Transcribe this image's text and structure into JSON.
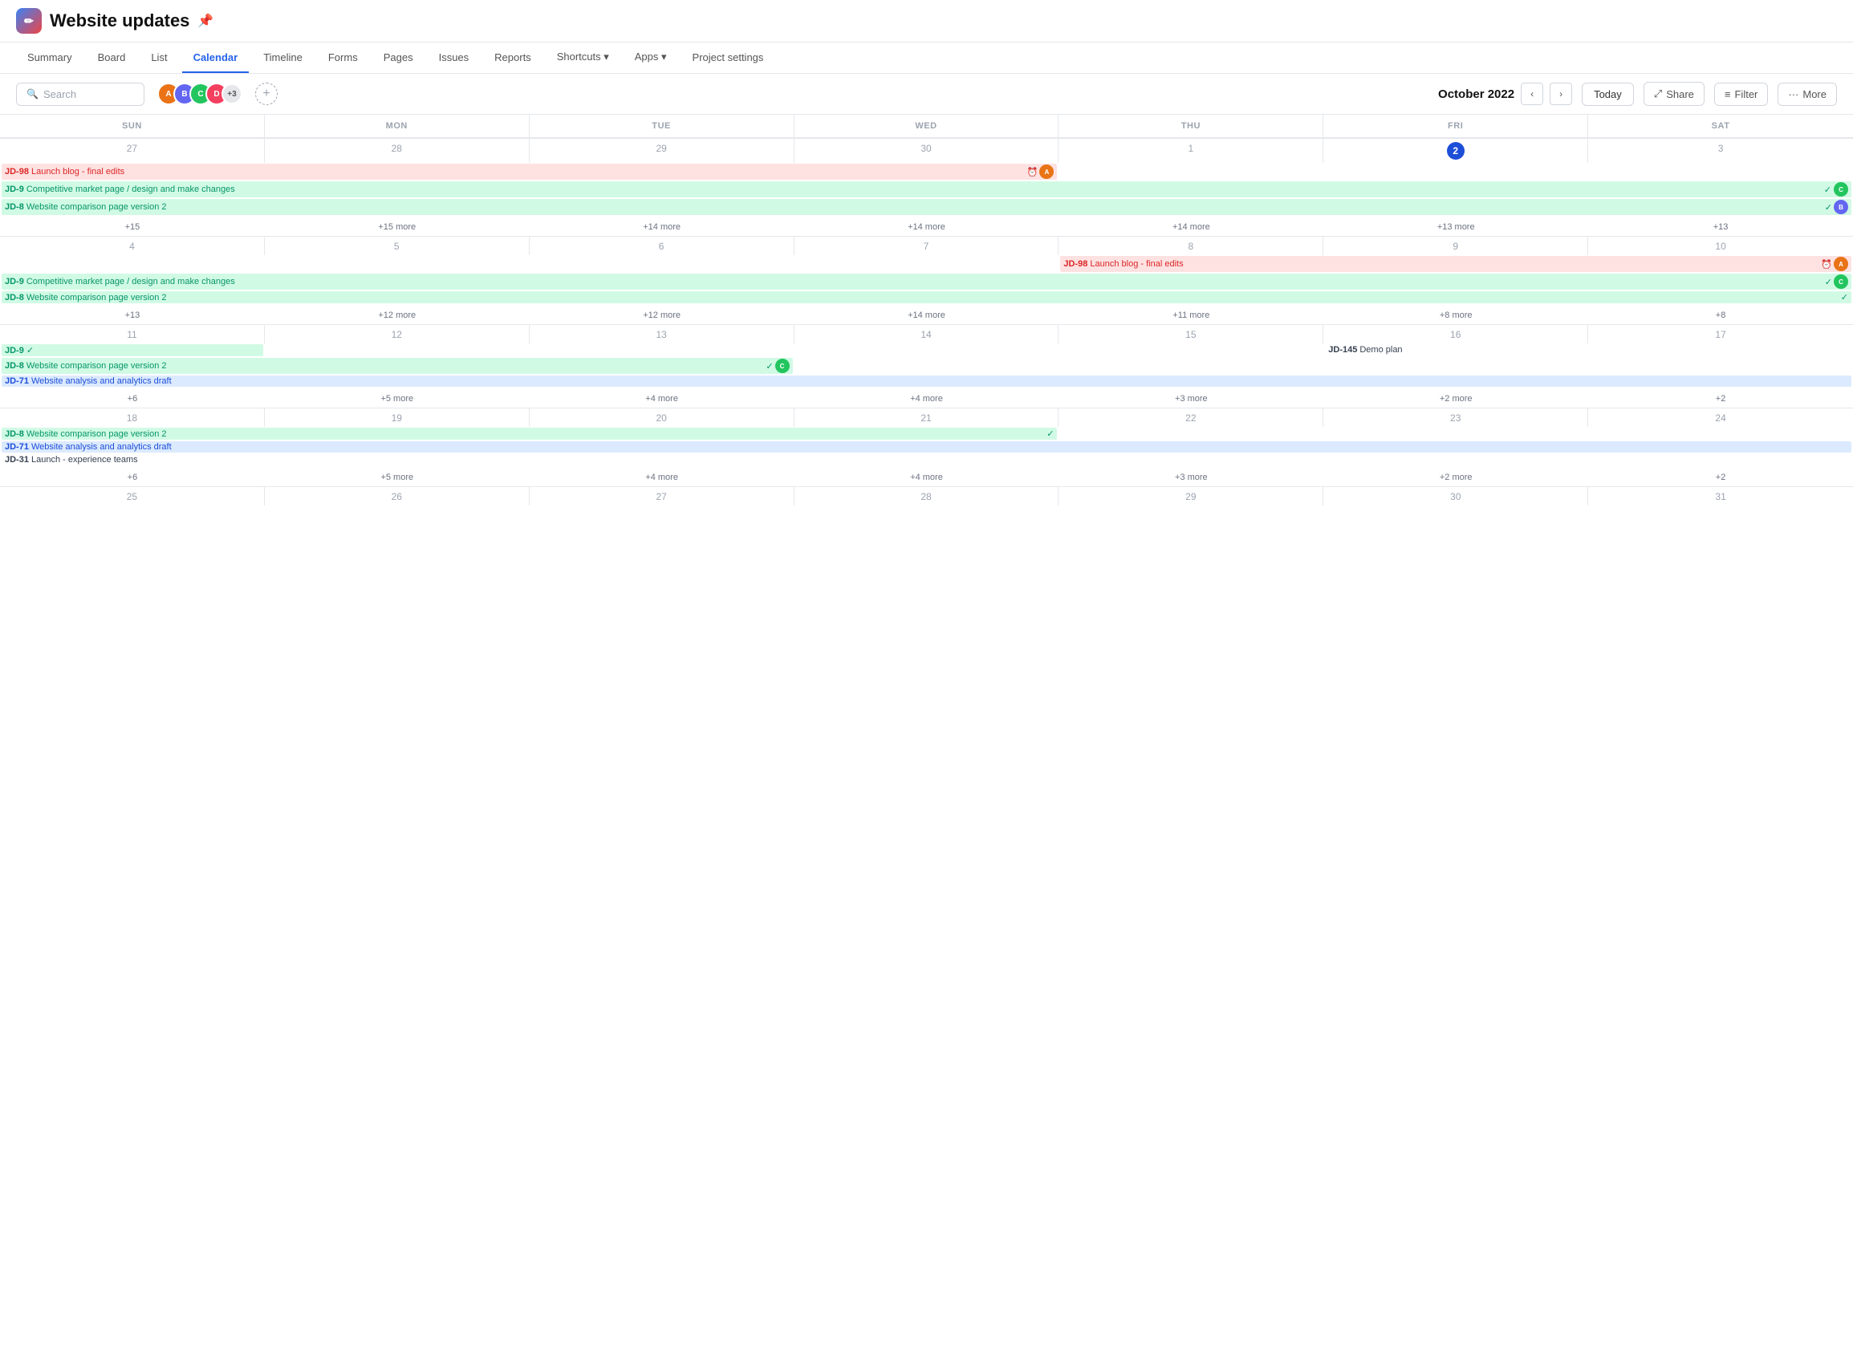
{
  "app": {
    "logo": "✏",
    "title": "Website updates",
    "pin_icon": "📌"
  },
  "nav": {
    "tabs": [
      {
        "id": "summary",
        "label": "Summary",
        "active": false
      },
      {
        "id": "board",
        "label": "Board",
        "active": false
      },
      {
        "id": "list",
        "label": "List",
        "active": false
      },
      {
        "id": "calendar",
        "label": "Calendar",
        "active": true
      },
      {
        "id": "timeline",
        "label": "Timeline",
        "active": false
      },
      {
        "id": "forms",
        "label": "Forms",
        "active": false
      },
      {
        "id": "pages",
        "label": "Pages",
        "active": false
      },
      {
        "id": "issues",
        "label": "Issues",
        "active": false
      },
      {
        "id": "reports",
        "label": "Reports",
        "active": false
      },
      {
        "id": "shortcuts",
        "label": "Shortcuts ▾",
        "active": false
      },
      {
        "id": "apps",
        "label": "Apps ▾",
        "active": false
      },
      {
        "id": "project-settings",
        "label": "Project settings",
        "active": false
      }
    ]
  },
  "toolbar": {
    "search_placeholder": "Search",
    "month_title": "October 2022",
    "today_label": "Today",
    "share_label": "Share",
    "filter_label": "Filter",
    "more_label": "More",
    "avatar_extra": "+3"
  },
  "calendar": {
    "day_headers": [
      "SUN",
      "MON",
      "TUE",
      "WED",
      "THU",
      "FRI",
      "SAT"
    ],
    "weeks": [
      {
        "days": [
          27,
          28,
          29,
          30,
          1,
          2,
          3
        ],
        "today_index": 5,
        "spanning_events": [
          {
            "label": "JD-98 Launch blog - final edits",
            "id": "JD-98",
            "title": "Launch blog - final edits",
            "type": "red",
            "start": 0,
            "end": 3,
            "has_overdue": true,
            "avatar_color": "#e97316"
          },
          {
            "label": "JD-9 Competitive market page / design and make changes",
            "id": "JD-9",
            "title": "Competitive market page / design and make changes",
            "type": "teal",
            "start": 0,
            "end": 6,
            "has_check": false
          },
          {
            "label": "JD-8 Website comparison page version 2",
            "id": "JD-8",
            "title": "Website comparison page version 2",
            "type": "teal",
            "start": 0,
            "end": 6,
            "has_check": true,
            "avatar_color": "#6366f1"
          }
        ],
        "more_counts": [
          15,
          15,
          14,
          14,
          14,
          13,
          13
        ]
      },
      {
        "days": [
          4,
          5,
          6,
          7,
          8,
          9,
          10
        ],
        "today_index": -1,
        "spanning_events": [
          {
            "label": "JD-98 Launch blog - final edits",
            "id": "JD-98",
            "title": "Launch blog - final edits",
            "type": "red",
            "start": 4,
            "end": 6,
            "has_overdue": true,
            "avatar_color": "#e97316"
          },
          {
            "label": "JD-9 Competitive market page / design and make changes",
            "id": "JD-9",
            "title": "Competitive market page / design and make changes",
            "type": "teal",
            "start": 0,
            "end": 6,
            "has_check": true,
            "avatar_color": "#22c55e"
          },
          {
            "label": "JD-8 Website comparison page version 2",
            "id": "JD-8",
            "title": "Website comparison page version 2",
            "type": "teal",
            "start": 0,
            "end": 6,
            "has_check": true
          }
        ],
        "more_counts": [
          13,
          12,
          12,
          14,
          11,
          8,
          8
        ]
      },
      {
        "days": [
          11,
          12,
          13,
          14,
          15,
          16,
          17
        ],
        "today_index": -1,
        "inline_events": [
          {
            "day_index": 0,
            "id": "JD-9",
            "title": "",
            "type": "teal",
            "has_check": true
          },
          {
            "day_index": 4,
            "id": "JD-145",
            "title": "Demo plan",
            "type": "none"
          }
        ],
        "spanning_events": [
          {
            "label": "JD-8 Website comparison page version 2",
            "id": "JD-8",
            "title": "Website comparison page version 2",
            "type": "teal",
            "start": 0,
            "end": 2,
            "has_check": true,
            "avatar_color": "#22c55e"
          },
          {
            "label": "JD-71 Website analysis and analytics draft",
            "id": "JD-71",
            "title": "Website analysis and analytics draft",
            "type": "blue",
            "start": 0,
            "end": 6
          }
        ],
        "more_counts": [
          6,
          5,
          4,
          4,
          3,
          2,
          2
        ]
      },
      {
        "days": [
          18,
          19,
          20,
          21,
          22,
          23,
          24
        ],
        "today_index": -1,
        "spanning_events": [
          {
            "label": "JD-8 Website comparison page version 2",
            "id": "JD-8",
            "title": "Website comparison page version 2",
            "type": "teal",
            "start": 0,
            "end": 3,
            "has_check": true
          },
          {
            "label": "JD-71 Website analysis and analytics draft",
            "id": "JD-71",
            "title": "Website analysis and analytics draft",
            "type": "blue",
            "start": 0,
            "end": 6
          },
          {
            "label": "JD-31 Launch - experience teams",
            "id": "JD-31",
            "title": "Launch - experience teams",
            "type": "none",
            "start": 0,
            "end": 6
          }
        ],
        "more_counts": [
          6,
          5,
          4,
          4,
          3,
          2,
          2
        ]
      },
      {
        "days": [
          25,
          26,
          27,
          28,
          29,
          30,
          31
        ],
        "today_index": -1,
        "spanning_events": [],
        "more_counts": [
          null,
          null,
          null,
          null,
          null,
          null,
          null
        ]
      }
    ]
  }
}
